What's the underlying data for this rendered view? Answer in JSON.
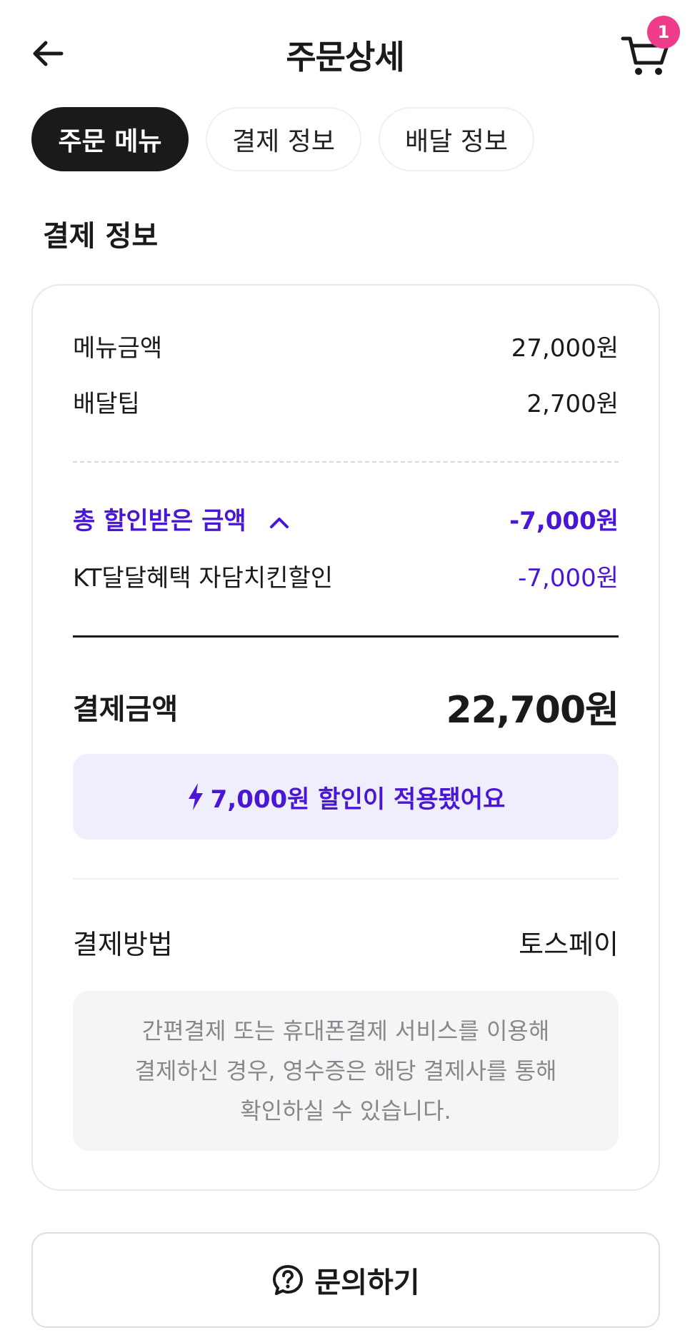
{
  "header": {
    "title": "주문상세",
    "cart_count": "1"
  },
  "tabs": [
    {
      "label": "주문 메뉴",
      "active": true
    },
    {
      "label": "결제 정보",
      "active": false
    },
    {
      "label": "배달 정보",
      "active": false
    }
  ],
  "section": {
    "title": "결제 정보"
  },
  "payment": {
    "menu_label": "메뉴금액",
    "menu_value": "27,000원",
    "tip_label": "배달팁",
    "tip_value": "2,700원",
    "discount_label": "총 할인받은 금액",
    "discount_value": "-7,000원",
    "discount_item_label": "KT달달혜택 자담치킨할인",
    "discount_item_value": "-7,000원",
    "total_label": "결제금액",
    "total_value": "22,700원",
    "banner_text": "7,000원 할인이 적용됐어요",
    "method_label": "결제방법",
    "method_value": "토스페이",
    "notice_lines": [
      "간편결제 또는 휴대폰결제 서비스를 이용해",
      "결제하신 경우, 영수증은 해당 결제사를 통해",
      "확인하실 수 있습니다."
    ]
  },
  "inquiry_label": "문의하기",
  "colors": {
    "accent": "#4a16d6",
    "badge": "#ee3c8a",
    "banner_bg": "#eeeefd",
    "dark": "#1a1a1a"
  }
}
